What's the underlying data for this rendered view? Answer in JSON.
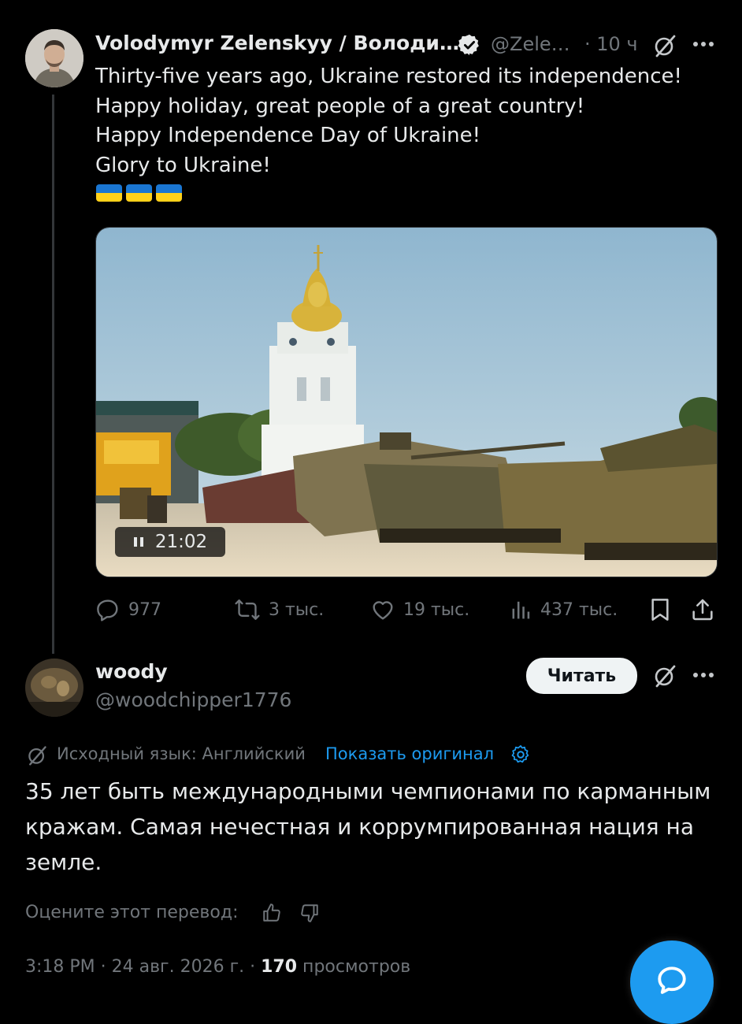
{
  "tweet": {
    "author_name": "Volodymyr Zelenskyy / Володи…",
    "author_handle": "@Zele…",
    "time": "· 10 ч",
    "lines": [
      "Thirty-five years ago, Ukraine restored its independence!",
      "Happy holiday, great people of a great country!",
      "Happy Independence Day of Ukraine!",
      "Glory to Ukraine!"
    ],
    "flags_emoji": "🇺🇦🇺🇦🇺🇦",
    "video": {
      "duration": "21:02",
      "state": "playing"
    },
    "actions": {
      "replies": "977",
      "reposts": "3 тыс.",
      "likes": "19 тыс.",
      "views": "437 тыс."
    }
  },
  "reply": {
    "author_name": "woody",
    "author_handle": "@woodchipper1776",
    "follow_label": "Читать",
    "translation_note": "Исходный язык: Английский",
    "show_original": "Показать оригинал",
    "text": "35 лет быть международными чемпионами по карманным кражам. Самая нечестная и коррумпированная нация на земле.",
    "rate_translation": "Оцените этот перевод:",
    "timestamp": "3:18 PM · 24 авг. 2026 г. · ",
    "views_count": "170",
    "views_label": " просмотров"
  },
  "colors": {
    "background": "#000000",
    "text": "#e7e9ea",
    "muted": "#71767b",
    "accent": "#1d9bf0",
    "verified": "#e7e9ea"
  },
  "icons": [
    "grok-icon",
    "more-icon",
    "reply-icon",
    "repost-icon",
    "like-icon",
    "views-icon",
    "bookmark-icon",
    "share-icon",
    "pause-icon",
    "verified-badge-icon",
    "settings-gear-icon",
    "thumbs-up-icon",
    "thumbs-down-icon",
    "message-icon"
  ]
}
